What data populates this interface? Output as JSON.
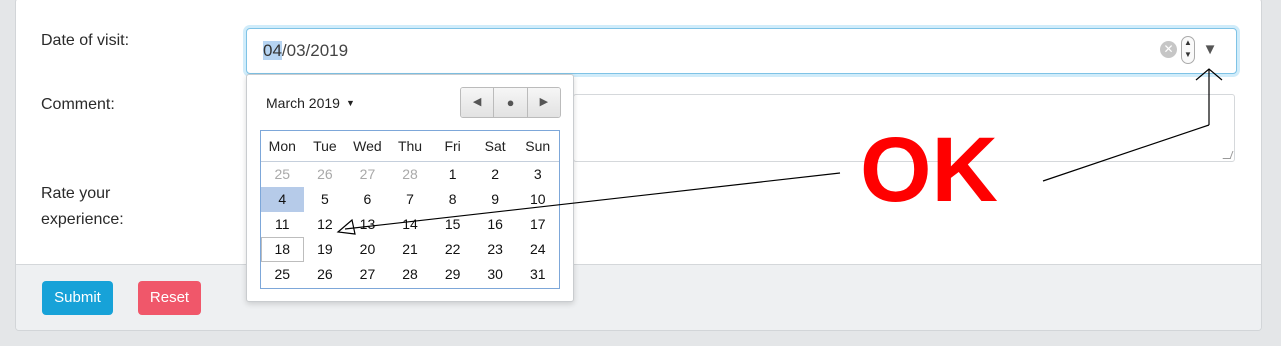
{
  "form": {
    "date_label": "Date of visit:",
    "comment_label": "Comment:",
    "rate_label_line1": "Rate your",
    "rate_label_line2": "experience:",
    "date_value_selected": "04",
    "date_value_rest": "/03/2019",
    "submit_label": "Submit",
    "reset_label": "Reset"
  },
  "calendar": {
    "month_label": "March 2019",
    "weekdays": [
      "Mon",
      "Tue",
      "Wed",
      "Thu",
      "Fri",
      "Sat",
      "Sun"
    ],
    "weeks": [
      [
        "25",
        "26",
        "27",
        "28",
        "1",
        "2",
        "3"
      ],
      [
        "4",
        "5",
        "6",
        "7",
        "8",
        "9",
        "10"
      ],
      [
        "11",
        "12",
        "13",
        "14",
        "15",
        "16",
        "17"
      ],
      [
        "18",
        "19",
        "20",
        "21",
        "22",
        "23",
        "24"
      ],
      [
        "25",
        "26",
        "27",
        "28",
        "29",
        "30",
        "31"
      ]
    ],
    "selected_day": "4",
    "today_day": "18"
  },
  "annotation": {
    "text": "OK",
    "color": "#ff0000"
  },
  "icons": {
    "clear": "clear-icon",
    "spinner": "spin-icon",
    "dropdown": "dropdown-icon",
    "prev": "prev-month-icon",
    "today": "today-icon",
    "next": "next-month-icon"
  }
}
